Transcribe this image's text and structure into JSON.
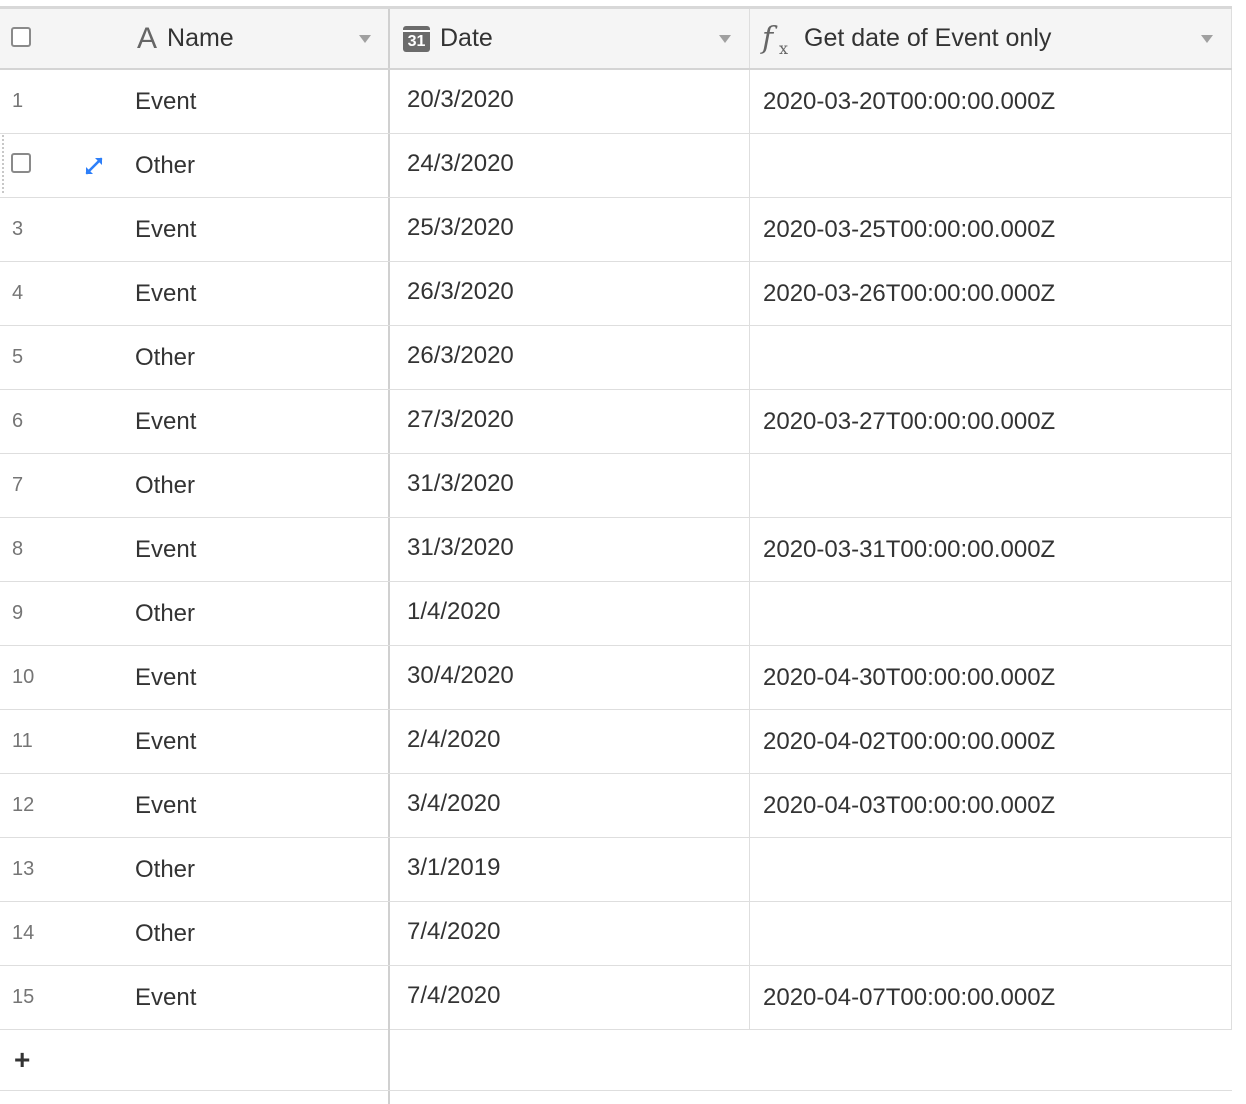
{
  "header": {
    "select_all": "",
    "columns": [
      {
        "label": "Name",
        "icon": "text-field-icon"
      },
      {
        "label": "Date",
        "icon": "calendar-icon",
        "icon_text": "31"
      },
      {
        "label": "Get date of Event only",
        "icon": "formula-icon"
      }
    ]
  },
  "rows": [
    {
      "num": "1",
      "name": "Event",
      "date": "20/3/2020",
      "formula": "2020-03-20T00:00:00.000Z"
    },
    {
      "num": "",
      "name": "Other",
      "date": "24/3/2020",
      "formula": "",
      "hovered": true
    },
    {
      "num": "3",
      "name": "Event",
      "date": "25/3/2020",
      "formula": "2020-03-25T00:00:00.000Z"
    },
    {
      "num": "4",
      "name": "Event",
      "date": "26/3/2020",
      "formula": "2020-03-26T00:00:00.000Z"
    },
    {
      "num": "5",
      "name": "Other",
      "date": "26/3/2020",
      "formula": ""
    },
    {
      "num": "6",
      "name": "Event",
      "date": "27/3/2020",
      "formula": "2020-03-27T00:00:00.000Z"
    },
    {
      "num": "7",
      "name": "Other",
      "date": "31/3/2020",
      "formula": ""
    },
    {
      "num": "8",
      "name": "Event",
      "date": "31/3/2020",
      "formula": "2020-03-31T00:00:00.000Z"
    },
    {
      "num": "9",
      "name": "Other",
      "date": "1/4/2020",
      "formula": ""
    },
    {
      "num": "10",
      "name": "Event",
      "date": "30/4/2020",
      "formula": "2020-04-30T00:00:00.000Z"
    },
    {
      "num": "11",
      "name": "Event",
      "date": "2/4/2020",
      "formula": "2020-04-02T00:00:00.000Z"
    },
    {
      "num": "12",
      "name": "Event",
      "date": "3/4/2020",
      "formula": "2020-04-03T00:00:00.000Z"
    },
    {
      "num": "13",
      "name": "Other",
      "date": "3/1/2019",
      "formula": ""
    },
    {
      "num": "14",
      "name": "Other",
      "date": "7/4/2020",
      "formula": ""
    },
    {
      "num": "15",
      "name": "Event",
      "date": "7/4/2020",
      "formula": "2020-04-07T00:00:00.000Z"
    }
  ],
  "add_row": {
    "label": "+"
  },
  "colors": {
    "header_bg": "#f5f5f5",
    "expand_icon": "#2d7ff9",
    "grid_line": "#dedede"
  }
}
